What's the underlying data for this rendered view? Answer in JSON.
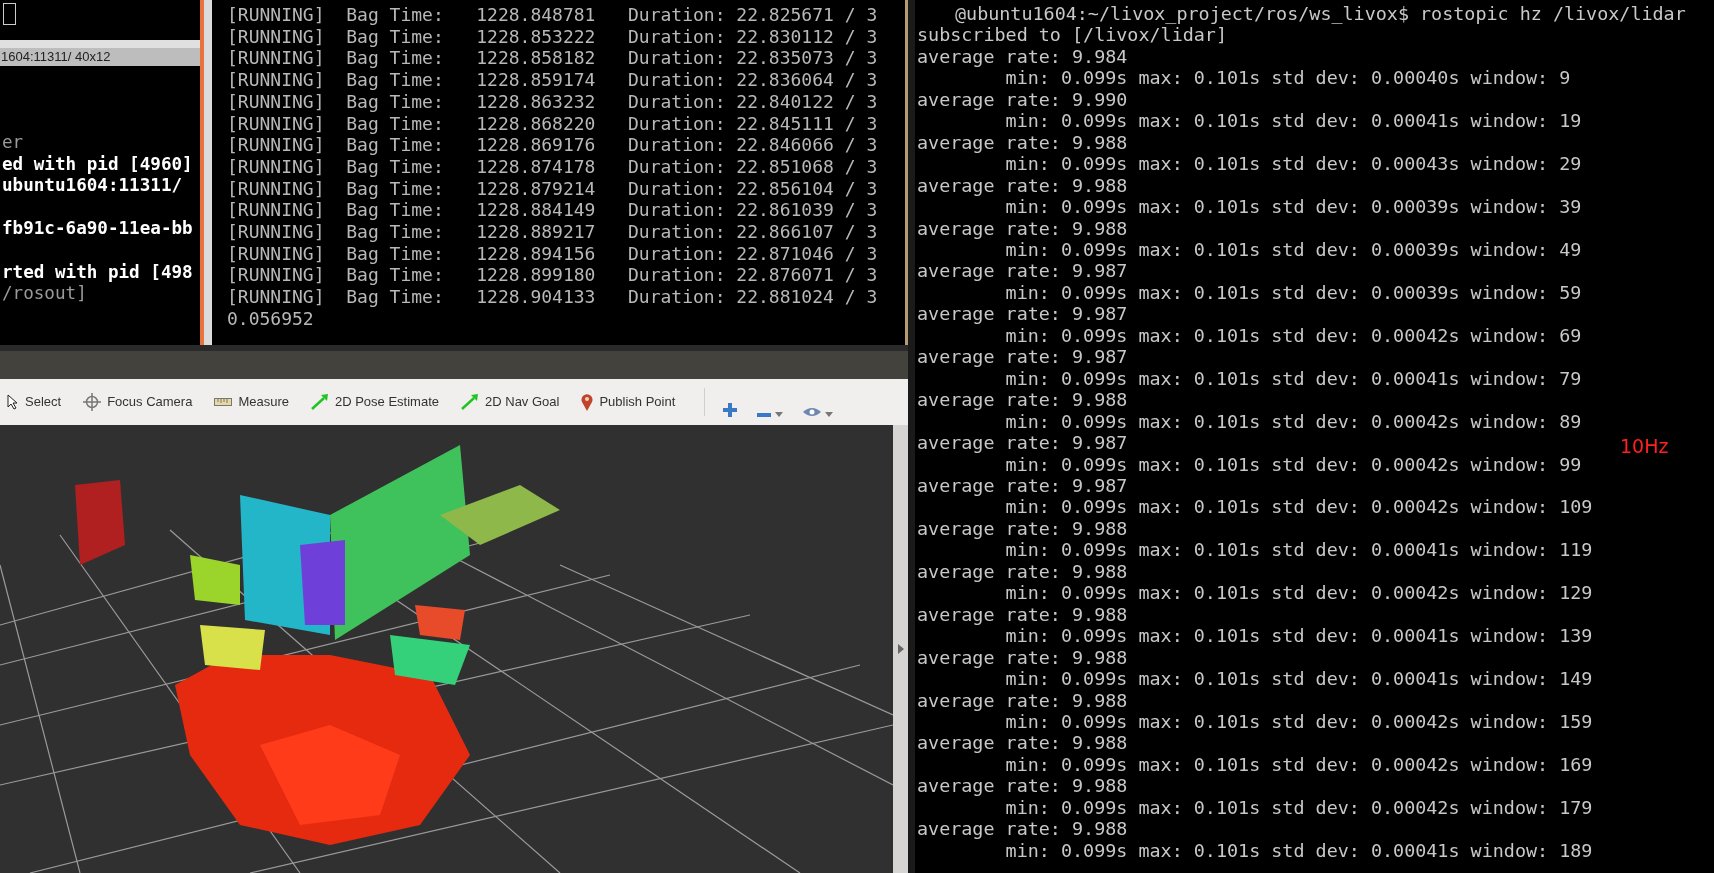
{
  "left_terminal": {
    "title": "1604:11311/ 40x12",
    "lines": [
      {
        "text": "er",
        "bold": false,
        "blank_before": false
      },
      {
        "text": "ed with pid [4960]",
        "bold": true,
        "blank_before": false
      },
      {
        "text": "ubuntu1604:11311/",
        "bold": true,
        "blank_before": false
      },
      {
        "text": "fb91c-6a90-11ea-bb",
        "bold": true,
        "blank_before": true
      },
      {
        "text": "rted with pid [498",
        "bold": true,
        "blank_before": true
      },
      {
        "text": "/rosout]",
        "bold": false,
        "blank_before": false
      }
    ]
  },
  "middle_terminal": {
    "lines": [
      "[RUNNING]  Bag Time:   1228.848781   Duration: 22.825671 / 3",
      "[RUNNING]  Bag Time:   1228.853222   Duration: 22.830112 / 3",
      "[RUNNING]  Bag Time:   1228.858182   Duration: 22.835073 / 3",
      "[RUNNING]  Bag Time:   1228.859174   Duration: 22.836064 / 3",
      "[RUNNING]  Bag Time:   1228.863232   Duration: 22.840122 / 3",
      "[RUNNING]  Bag Time:   1228.868220   Duration: 22.845111 / 3",
      "[RUNNING]  Bag Time:   1228.869176   Duration: 22.846066 / 3",
      "[RUNNING]  Bag Time:   1228.874178   Duration: 22.851068 / 3",
      "[RUNNING]  Bag Time:   1228.879214   Duration: 22.856104 / 3",
      "[RUNNING]  Bag Time:   1228.884149   Duration: 22.861039 / 3",
      "[RUNNING]  Bag Time:   1228.889217   Duration: 22.866107 / 3",
      "[RUNNING]  Bag Time:   1228.894156   Duration: 22.871046 / 3",
      "[RUNNING]  Bag Time:   1228.899180   Duration: 22.876071 / 3",
      "[RUNNING]  Bag Time:   1228.904133   Duration: 22.881024 / 3"
    ],
    "last_line": "0.056952"
  },
  "rviz": {
    "tools": [
      {
        "label": "Select",
        "kind": "select"
      },
      {
        "label": "Focus Camera",
        "kind": "focus"
      },
      {
        "label": "Measure",
        "kind": "measure"
      },
      {
        "label": "2D Pose Estimate",
        "kind": "arrow"
      },
      {
        "label": "2D Nav Goal",
        "kind": "arrow"
      },
      {
        "label": "Publish Point",
        "kind": "pin"
      }
    ],
    "view_buttons": [
      {
        "kind": "plus",
        "dropdown": false
      },
      {
        "kind": "minus",
        "dropdown": true
      },
      {
        "kind": "eye",
        "dropdown": true
      }
    ]
  },
  "right_terminal": {
    "command": "@ubuntu1604:~/livox_project/ros/ws_livox$ rostopic hz /livox/lidar",
    "subscribed": "subscribed to [/livox/lidar]",
    "readings": [
      {
        "average": "average rate: 9.984",
        "stats": "min: 0.099s max: 0.101s std dev: 0.00040s window: 9"
      },
      {
        "average": "average rate: 9.990",
        "stats": "min: 0.099s max: 0.101s std dev: 0.00041s window: 19"
      },
      {
        "average": "average rate: 9.988",
        "stats": "min: 0.099s max: 0.101s std dev: 0.00043s window: 29"
      },
      {
        "average": "average rate: 9.988",
        "stats": "min: 0.099s max: 0.101s std dev: 0.00039s window: 39"
      },
      {
        "average": "average rate: 9.988",
        "stats": "min: 0.099s max: 0.101s std dev: 0.00039s window: 49"
      },
      {
        "average": "average rate: 9.987",
        "stats": "min: 0.099s max: 0.101s std dev: 0.00039s window: 59"
      },
      {
        "average": "average rate: 9.987",
        "stats": "min: 0.099s max: 0.101s std dev: 0.00042s window: 69"
      },
      {
        "average": "average rate: 9.987",
        "stats": "min: 0.099s max: 0.101s std dev: 0.00041s window: 79"
      },
      {
        "average": "average rate: 9.988",
        "stats": "min: 0.099s max: 0.101s std dev: 0.00042s window: 89"
      },
      {
        "average": "average rate: 9.987",
        "stats": "min: 0.099s max: 0.101s std dev: 0.00042s window: 99"
      },
      {
        "average": "average rate: 9.987",
        "stats": "min: 0.099s max: 0.101s std dev: 0.00042s window: 109"
      },
      {
        "average": "average rate: 9.988",
        "stats": "min: 0.099s max: 0.101s std dev: 0.00041s window: 119"
      },
      {
        "average": "average rate: 9.988",
        "stats": "min: 0.099s max: 0.101s std dev: 0.00042s window: 129"
      },
      {
        "average": "average rate: 9.988",
        "stats": "min: 0.099s max: 0.101s std dev: 0.00041s window: 139"
      },
      {
        "average": "average rate: 9.988",
        "stats": "min: 0.099s max: 0.101s std dev: 0.00041s window: 149"
      },
      {
        "average": "average rate: 9.988",
        "stats": "min: 0.099s max: 0.101s std dev: 0.00042s window: 159"
      },
      {
        "average": "average rate: 9.988",
        "stats": "min: 0.099s max: 0.101s std dev: 0.00042s window: 169"
      },
      {
        "average": "average rate: 9.988",
        "stats": "min: 0.099s max: 0.101s std dev: 0.00042s window: 179"
      },
      {
        "average": "average rate: 9.988",
        "stats": "min: 0.099s max: 0.101s std dev: 0.00041s window: 189"
      }
    ]
  },
  "annotation": {
    "text": "10Hz"
  }
}
